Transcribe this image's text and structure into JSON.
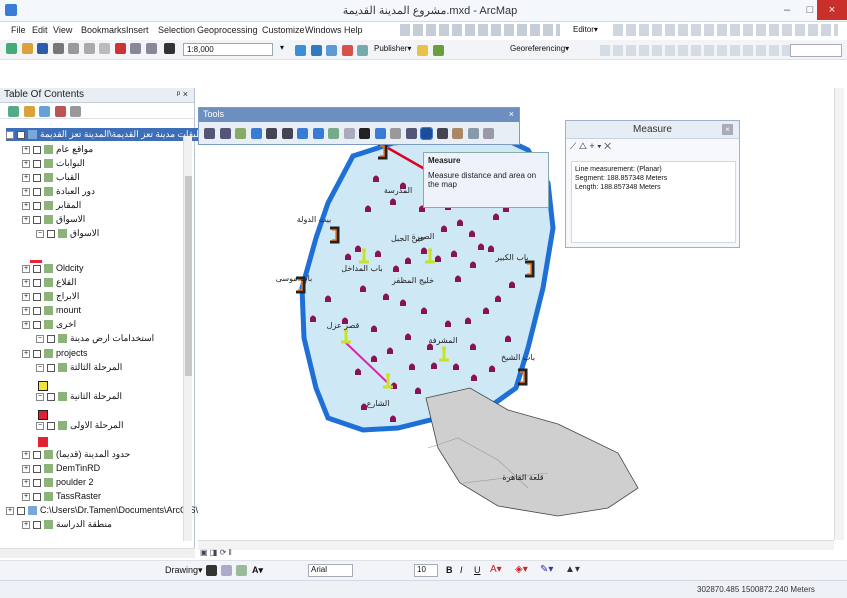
{
  "window": {
    "title": "مشروع المدينة القديمة.mxd - ArcMap",
    "controls": [
      "–",
      "□",
      "×"
    ]
  },
  "menu": [
    "File",
    "Edit",
    "View",
    "Bookmarks",
    "Insert",
    "Selection",
    "Geoprocessing",
    "Customize",
    "Windows",
    "Help"
  ],
  "toolbar": {
    "scale": "1:8,000",
    "editor_label": "Editor▾",
    "publisher_label": "Publisher▾",
    "georef_label": "Georeferencing▾"
  },
  "toc": {
    "title": "Table Of Contents",
    "close": "ᵖ ×",
    "rows": [
      {
        "label": "طبقات مدينة تعز القديمة\\المدينة تعز القديمة.lyr",
        "kind": "group",
        "selected": true
      },
      {
        "label": "مواقع عام",
        "kind": "layer"
      },
      {
        "label": "البوابات",
        "kind": "layer"
      },
      {
        "label": "القباب",
        "kind": "layer"
      },
      {
        "label": "دور العبادة",
        "kind": "layer"
      },
      {
        "label": "المقابر",
        "kind": "layer"
      },
      {
        "label": "الاسواق",
        "kind": "layer"
      },
      {
        "label": "الاسواق",
        "kind": "sublayer"
      },
      {
        "label": "Oldcity",
        "kind": "layer"
      },
      {
        "label": "القلاع",
        "kind": "layer"
      },
      {
        "label": "الابراج",
        "kind": "layer"
      },
      {
        "label": "mount",
        "kind": "layer"
      },
      {
        "label": "اخرى",
        "kind": "layer"
      },
      {
        "label": "استخدامات ارض مدينة",
        "kind": "sublayer"
      },
      {
        "label": "projects",
        "kind": "layer"
      },
      {
        "label": "المرحلة الثالثة",
        "kind": "sublayer"
      },
      {
        "label": "المرحلة الثانية",
        "kind": "sublayer"
      },
      {
        "label": "المرحلة الاولى",
        "kind": "sublayer"
      },
      {
        "label": "حدود المدينة (قديما)",
        "kind": "layer"
      },
      {
        "label": "DemTinRD",
        "kind": "layer"
      },
      {
        "label": "poulder 2",
        "kind": "layer"
      },
      {
        "label": "TassRaster",
        "kind": "layer"
      },
      {
        "label": "C:\\Users\\Dr.Tamen\\Documents\\ArcGIS\\",
        "kind": "group"
      },
      {
        "label": "منطقة الدراسة",
        "kind": "layer"
      }
    ]
  },
  "tools_panel": {
    "title": "Tools",
    "close": "×"
  },
  "tooltip": {
    "title": "Measure",
    "text": "Measure distance and area on the map"
  },
  "measure": {
    "title": "Measure",
    "lines": [
      "Line measurement: (Planar)",
      "Segment: 188.857348 Meters",
      "Length: 188.857348 Meters"
    ]
  },
  "map_labels": [
    "بيت الدولة",
    "باب موسى",
    "باب المداخل",
    "عين الجبل",
    "خليج المظفر",
    "المدرسة",
    "باب الكبير",
    "قصر عزل",
    "المشرفة",
    "الشارع",
    "باب الشيخ",
    "قلعة القاهرة",
    "الصيرة"
  ],
  "drawing": {
    "label": "Drawing▾",
    "font": "Arial",
    "size": "10"
  },
  "status": {
    "coords": "302870.485  1500872.240 Meters"
  },
  "colors": {
    "city": "#cfe8f6",
    "wall": "#1e6fd6",
    "castle": "#cfcfcf",
    "poi": "#8a1453",
    "line": "#e21fb0"
  }
}
